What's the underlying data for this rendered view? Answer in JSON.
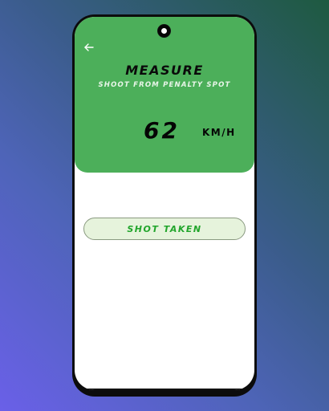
{
  "header": {
    "back_icon": "arrow-left-icon",
    "title": "MEASURE",
    "subtitle": "SHOOT FROM PENALTY SPOT"
  },
  "speed": {
    "value": "62",
    "unit": "KM/H"
  },
  "actions": {
    "shot_taken_label": "SHOT TAKEN"
  },
  "colors": {
    "header_green": "#4caf5a",
    "button_text_green": "#21a52b",
    "button_fill": "#e6f3dc"
  }
}
